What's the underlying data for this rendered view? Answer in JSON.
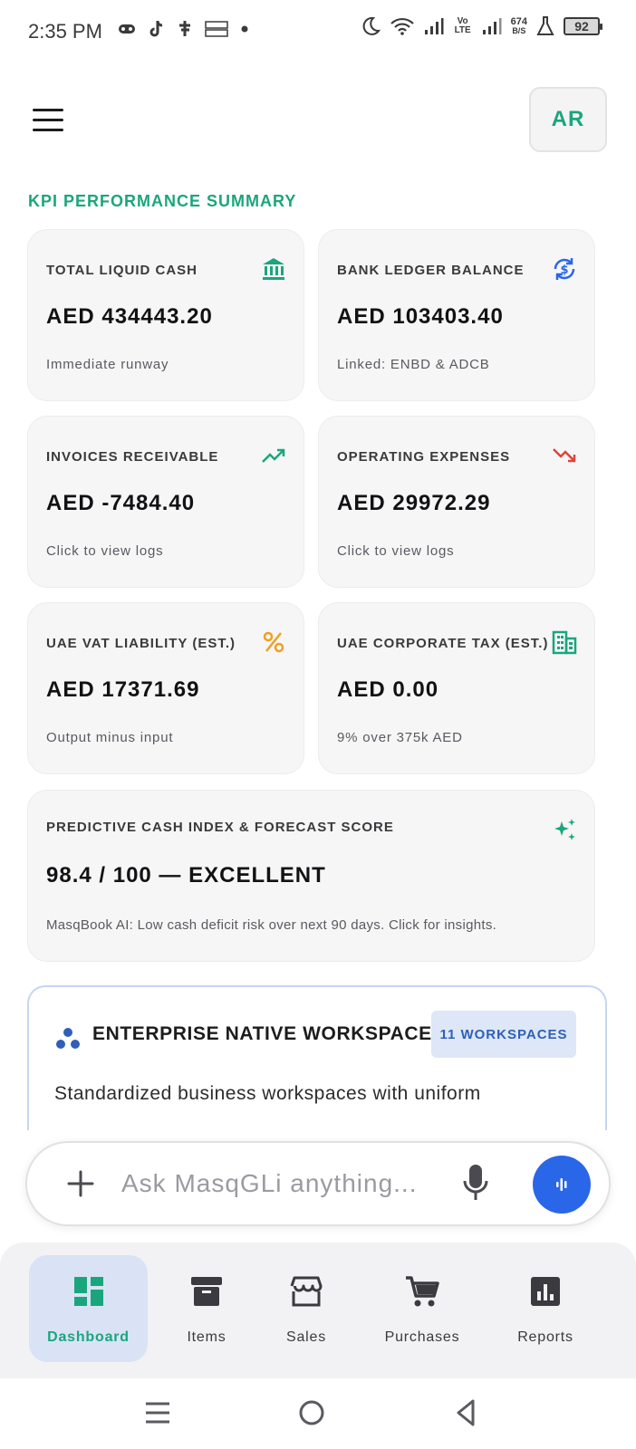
{
  "status_bar": {
    "time": "2:35 PM",
    "left_icons": [
      "game-controller-icon",
      "tiktok-icon",
      "temu-t-icon",
      "temu-logo-icon",
      "dot-icon"
    ],
    "right_icons": [
      "moon-icon",
      "wifi-icon",
      "signal-icon",
      "volte-icon",
      "signal-icon",
      "speed-icon",
      "flask-icon",
      "battery-icon"
    ],
    "volte": "Vo LTE",
    "net_speed_value": "674",
    "net_speed_unit": "B/S",
    "battery": "92"
  },
  "header": {
    "menu_icon": "hamburger-menu-icon",
    "avatar_initials": "AR"
  },
  "section_title": "KPI PERFORMANCE SUMMARY",
  "kpis": [
    {
      "label": "TOTAL LIQUID CASH",
      "value": "AED 434443.20",
      "sub": "Immediate runway",
      "icon": "bank-icon",
      "icon_color": "#1aa67c"
    },
    {
      "label": "BANK LEDGER BALANCE",
      "value": "AED 103403.40",
      "sub": "Linked: ENBD & ADCB",
      "icon": "currency-exchange-icon",
      "icon_color": "#2a66e8"
    },
    {
      "label": "INVOICES RECEIVABLE",
      "value": "AED -7484.40",
      "sub": "Click to view logs",
      "icon": "trending-up-icon",
      "icon_color": "#1aa67c"
    },
    {
      "label": "OPERATING EXPENSES",
      "value": "AED 29972.29",
      "sub": "Click to view logs",
      "icon": "trending-down-icon",
      "icon_color": "#e0443a"
    },
    {
      "label": "UAE VAT LIABILITY (EST.)",
      "value": "AED 17371.69",
      "sub": "Output minus input",
      "icon": "percent-icon",
      "icon_color": "#f0a020"
    },
    {
      "label": "UAE CORPORATE TAX (EST.)",
      "value": "AED 0.00",
      "sub": "9% over 375k AED",
      "icon": "building-icon",
      "icon_color": "#1aa67c"
    }
  ],
  "forecast": {
    "label": "PREDICTIVE CASH INDEX & FORECAST SCORE",
    "value": "98.4 / 100 — EXCELLENT",
    "sub": "MasqBook AI: Low cash deficit risk over next 90 days. Click for insights.",
    "icon": "sparkles-icon",
    "icon_color": "#1aa67c"
  },
  "enterprise": {
    "title": "ENTERPRISE NATIVE WORKSPACES",
    "badge": "11 WORKSPACES",
    "text": "Standardized business workspaces with uniform",
    "icon": "workspaces-dots-icon"
  },
  "ask_bar": {
    "placeholder": "Ask MasqGLi anything...",
    "value": "",
    "accent": "#2a66e8"
  },
  "bottom_nav": [
    {
      "label": "Dashboard",
      "icon": "dashboard-icon",
      "active": true
    },
    {
      "label": "Items",
      "icon": "archive-box-icon",
      "active": false
    },
    {
      "label": "Sales",
      "icon": "storefront-icon",
      "active": false
    },
    {
      "label": "Purchases",
      "icon": "shopping-cart-icon",
      "active": false
    },
    {
      "label": "Reports",
      "icon": "bar-chart-icon",
      "active": false
    }
  ],
  "system_nav": [
    "recents-icon",
    "home-circle-icon",
    "back-triangle-icon"
  ],
  "colors": {
    "accent_green": "#1aa67c",
    "accent_blue": "#2a66e8",
    "active_nav_bg": "#d9e3f5",
    "card_bg": "#f6f6f7"
  }
}
